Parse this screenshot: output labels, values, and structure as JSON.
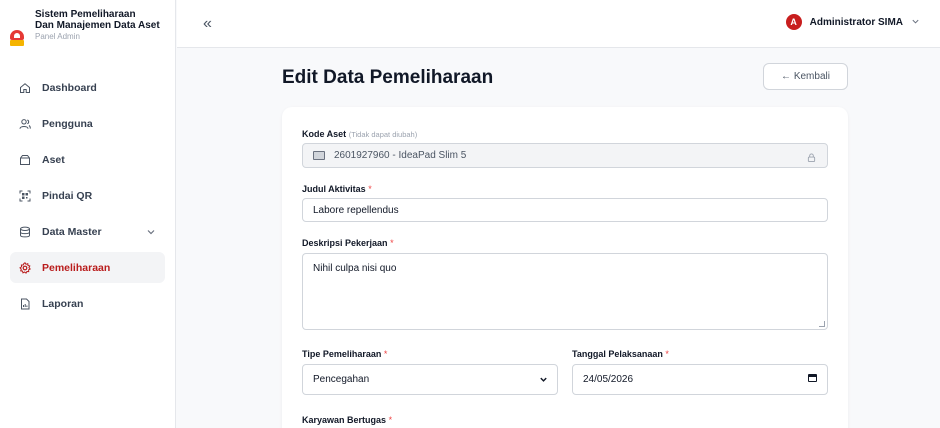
{
  "brand": {
    "title_line1": "Sistem Pemeliharaan",
    "title_line2": "Dan Manajemen Data Aset",
    "subtitle": "Panel Admin"
  },
  "sidebar": {
    "items": [
      {
        "label": "Dashboard",
        "icon": "home-icon"
      },
      {
        "label": "Pengguna",
        "icon": "users-icon"
      },
      {
        "label": "Aset",
        "icon": "box-icon"
      },
      {
        "label": "Pindai QR",
        "icon": "qr-scan-icon"
      },
      {
        "label": "Data Master",
        "icon": "database-icon"
      },
      {
        "label": "Pemeliharaan",
        "icon": "gear-icon"
      },
      {
        "label": "Laporan",
        "icon": "document-icon"
      }
    ]
  },
  "topbar": {
    "collapse_glyph": "«",
    "user_initial": "A",
    "user_name": "Administrator SIMA"
  },
  "page": {
    "title": "Edit Data Pemeliharaan",
    "back_label": "← Kembali"
  },
  "form": {
    "kode_aset": {
      "label": "Kode Aset",
      "hint": "(Tidak dapat diubah)",
      "value": "2601927960 - IdeaPad Slim 5"
    },
    "judul": {
      "label": "Judul Aktivitas",
      "required": "*",
      "value": "Labore repellendus"
    },
    "deskripsi": {
      "label": "Deskripsi Pekerjaan",
      "required": "*",
      "value": "Nihil culpa nisi quo"
    },
    "tipe": {
      "label": "Tipe Pemeliharaan",
      "required": "*",
      "value": "Pencegahan"
    },
    "tanggal": {
      "label": "Tanggal Pelaksanaan",
      "required": "*",
      "value": "24/05/2026"
    },
    "karyawan": {
      "label": "Karyawan Bertugas",
      "required": "*"
    }
  },
  "colors": {
    "accent": "#b91c1c",
    "avatar": "#c81e1e",
    "required": "#ef4444"
  }
}
